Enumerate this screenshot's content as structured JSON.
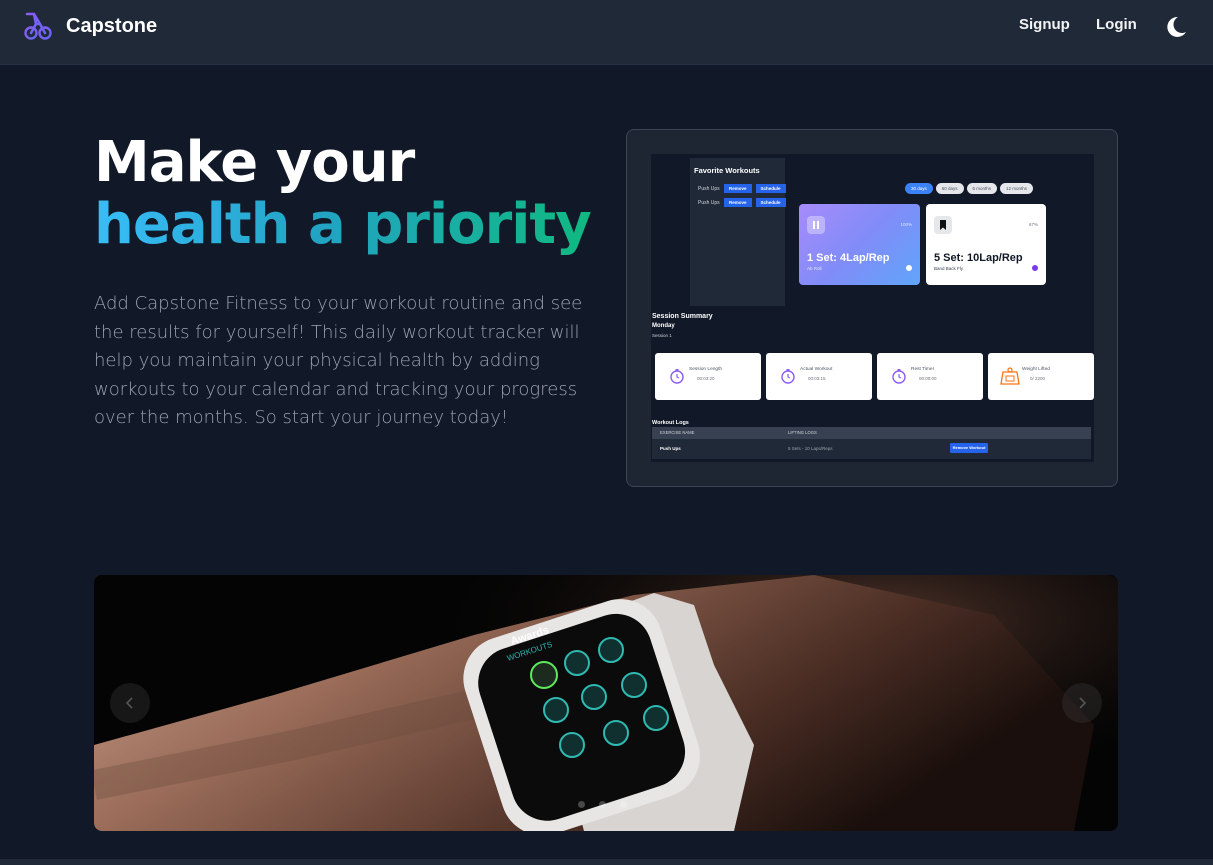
{
  "brand": {
    "name": "Capstone",
    "logo_icon": "bicycle-logo-icon"
  },
  "nav": {
    "signup": "Signup",
    "login": "Login",
    "theme_icon": "moon-icon"
  },
  "hero": {
    "title_line1": "Make your",
    "title_line2": "health a priority",
    "description": "Add Capstone Fitness to your workout routine and see the results for yourself! This daily workout tracker will help you maintain your physical health by adding workouts to your calendar and tracking your progress over the months. So start your journey today!"
  },
  "preview": {
    "favorites": {
      "title": "Favorite Workouts",
      "rows": [
        {
          "name": "Push Ups",
          "remove": "Remove",
          "schedule": "Schedule"
        },
        {
          "name": "Push Ups",
          "remove": "Remove",
          "schedule": "Schedule"
        }
      ]
    },
    "ranges": [
      "30 days",
      "60 days",
      "6 months",
      "12 months"
    ],
    "cards": [
      {
        "pct": "100%",
        "big": "1 Set: 4Lap/Rep",
        "sub": "Ab Roll"
      },
      {
        "pct": "67%",
        "big": "5 Set: 10Lap/Rep",
        "sub": "Band Back Fly"
      }
    ],
    "summary": {
      "title": "Session Summary",
      "day": "Monday",
      "session": "Session 1"
    },
    "stats": [
      {
        "label": "Session Length",
        "value": "00:03:20"
      },
      {
        "label": "Actual Workout",
        "value": "00:03:15"
      },
      {
        "label": "Rest Timer",
        "value": "00:00:00"
      },
      {
        "label": "Weight Lifted",
        "value": "0/ 2200"
      }
    ],
    "logs": {
      "title": "Workout Logs",
      "col1": "EXERCISE NAME",
      "col2": "LIFTING LOGS",
      "row_name": "Push Ups",
      "row_log": "5 Sets - 10 Laps/Reps",
      "row_btn": "Remove Workout"
    }
  },
  "carousel": {
    "watch_title": "Awards",
    "watch_subtitle": "WORKOUTS",
    "prev_icon": "chevron-left-icon",
    "next_icon": "chevron-right-icon",
    "slide_count": 3
  }
}
